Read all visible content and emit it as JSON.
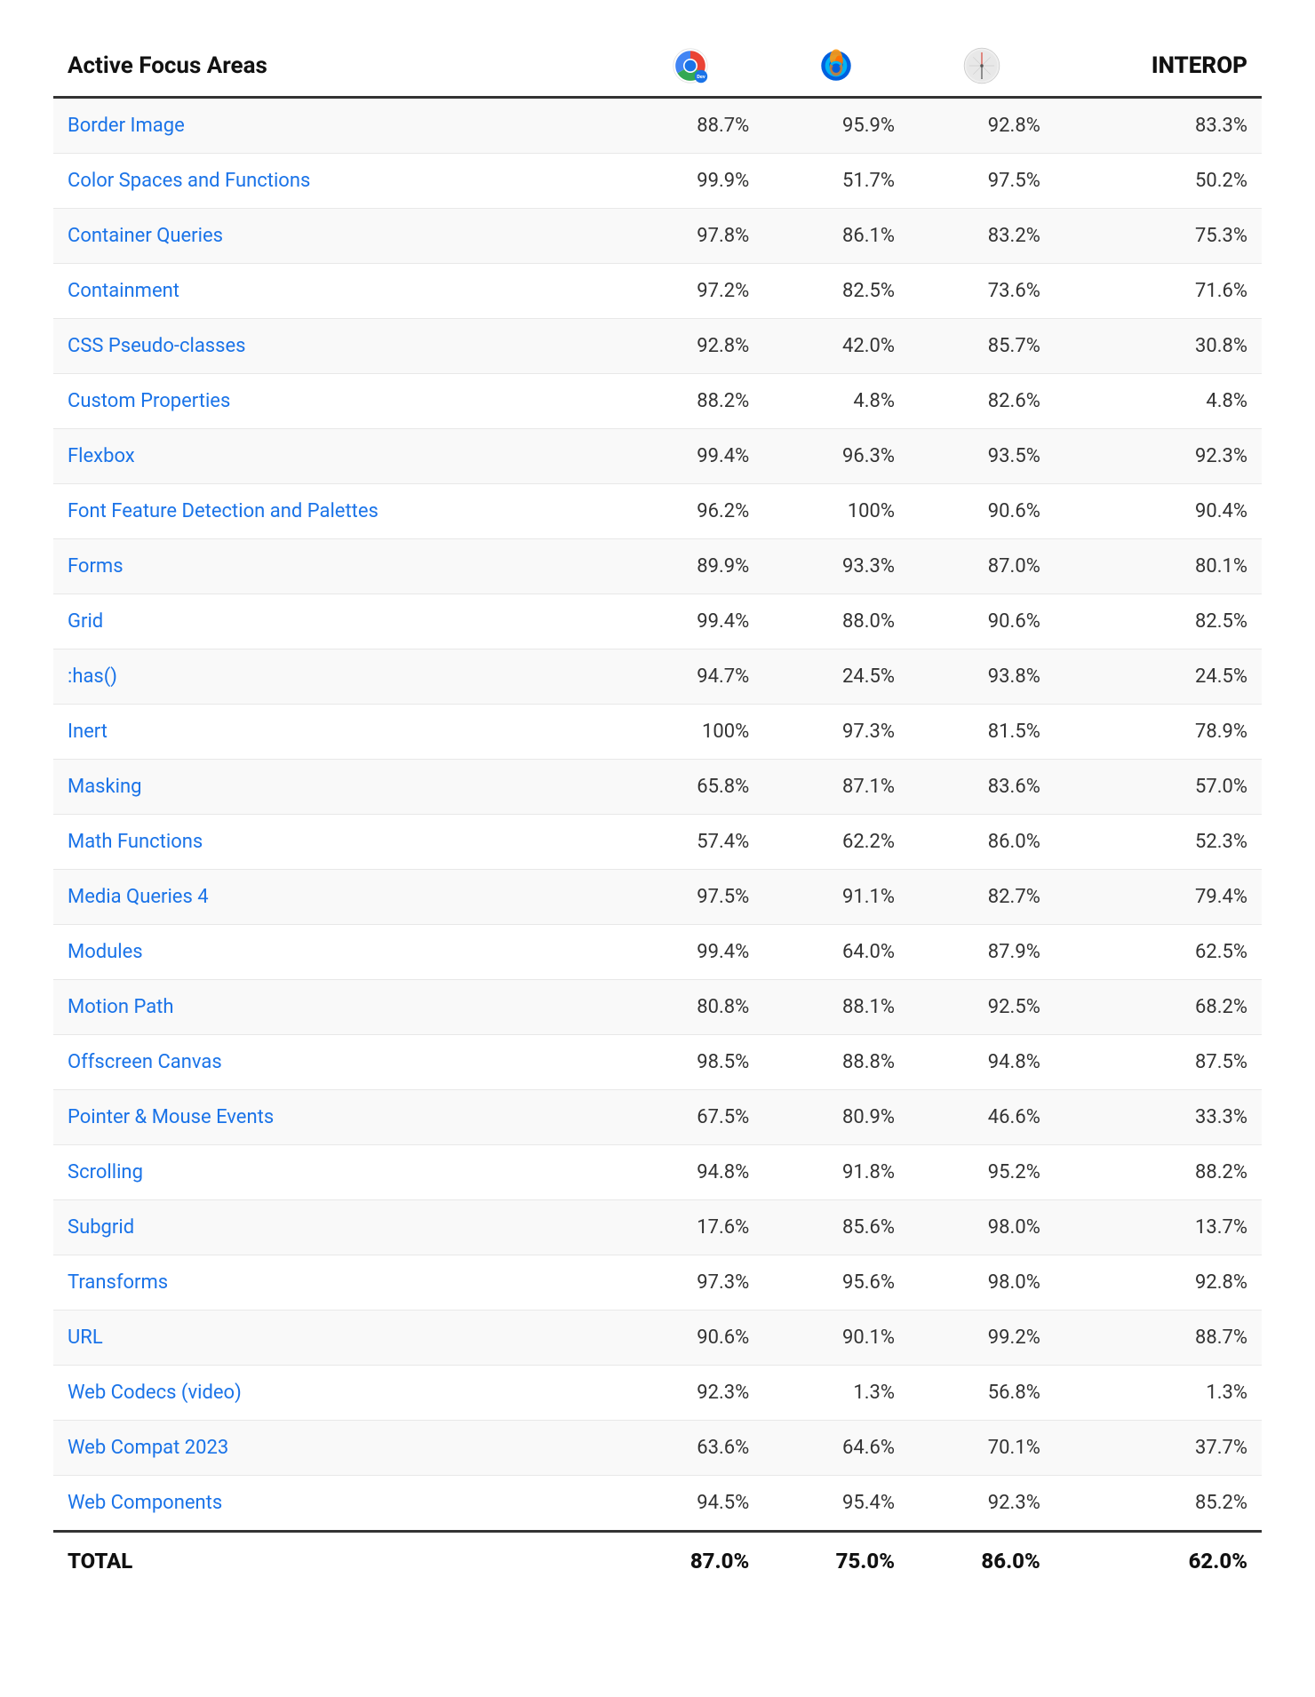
{
  "header": {
    "area_col_label": "Active Focus Areas",
    "interop_label": "INTEROP"
  },
  "rows": [
    {
      "name": "Border Image",
      "chrome": "88.7%",
      "firefox": "95.9%",
      "safari": "92.8%",
      "interop": "83.3%"
    },
    {
      "name": "Color Spaces and Functions",
      "chrome": "99.9%",
      "firefox": "51.7%",
      "safari": "97.5%",
      "interop": "50.2%"
    },
    {
      "name": "Container Queries",
      "chrome": "97.8%",
      "firefox": "86.1%",
      "safari": "83.2%",
      "interop": "75.3%"
    },
    {
      "name": "Containment",
      "chrome": "97.2%",
      "firefox": "82.5%",
      "safari": "73.6%",
      "interop": "71.6%"
    },
    {
      "name": "CSS Pseudo-classes",
      "chrome": "92.8%",
      "firefox": "42.0%",
      "safari": "85.7%",
      "interop": "30.8%"
    },
    {
      "name": "Custom Properties",
      "chrome": "88.2%",
      "firefox": "4.8%",
      "safari": "82.6%",
      "interop": "4.8%"
    },
    {
      "name": "Flexbox",
      "chrome": "99.4%",
      "firefox": "96.3%",
      "safari": "93.5%",
      "interop": "92.3%"
    },
    {
      "name": "Font Feature Detection and Palettes",
      "chrome": "96.2%",
      "firefox": "100%",
      "safari": "90.6%",
      "interop": "90.4%"
    },
    {
      "name": "Forms",
      "chrome": "89.9%",
      "firefox": "93.3%",
      "safari": "87.0%",
      "interop": "80.1%"
    },
    {
      "name": "Grid",
      "chrome": "99.4%",
      "firefox": "88.0%",
      "safari": "90.6%",
      "interop": "82.5%"
    },
    {
      "name": ":has()",
      "chrome": "94.7%",
      "firefox": "24.5%",
      "safari": "93.8%",
      "interop": "24.5%"
    },
    {
      "name": "Inert",
      "chrome": "100%",
      "firefox": "97.3%",
      "safari": "81.5%",
      "interop": "78.9%"
    },
    {
      "name": "Masking",
      "chrome": "65.8%",
      "firefox": "87.1%",
      "safari": "83.6%",
      "interop": "57.0%"
    },
    {
      "name": "Math Functions",
      "chrome": "57.4%",
      "firefox": "62.2%",
      "safari": "86.0%",
      "interop": "52.3%"
    },
    {
      "name": "Media Queries 4",
      "chrome": "97.5%",
      "firefox": "91.1%",
      "safari": "82.7%",
      "interop": "79.4%"
    },
    {
      "name": "Modules",
      "chrome": "99.4%",
      "firefox": "64.0%",
      "safari": "87.9%",
      "interop": "62.5%"
    },
    {
      "name": "Motion Path",
      "chrome": "80.8%",
      "firefox": "88.1%",
      "safari": "92.5%",
      "interop": "68.2%"
    },
    {
      "name": "Offscreen Canvas",
      "chrome": "98.5%",
      "firefox": "88.8%",
      "safari": "94.8%",
      "interop": "87.5%"
    },
    {
      "name": "Pointer & Mouse Events",
      "chrome": "67.5%",
      "firefox": "80.9%",
      "safari": "46.6%",
      "interop": "33.3%"
    },
    {
      "name": "Scrolling",
      "chrome": "94.8%",
      "firefox": "91.8%",
      "safari": "95.2%",
      "interop": "88.2%"
    },
    {
      "name": "Subgrid",
      "chrome": "17.6%",
      "firefox": "85.6%",
      "safari": "98.0%",
      "interop": "13.7%"
    },
    {
      "name": "Transforms",
      "chrome": "97.3%",
      "firefox": "95.6%",
      "safari": "98.0%",
      "interop": "92.8%"
    },
    {
      "name": "URL",
      "chrome": "90.6%",
      "firefox": "90.1%",
      "safari": "99.2%",
      "interop": "88.7%"
    },
    {
      "name": "Web Codecs (video)",
      "chrome": "92.3%",
      "firefox": "1.3%",
      "safari": "56.8%",
      "interop": "1.3%"
    },
    {
      "name": "Web Compat 2023",
      "chrome": "63.6%",
      "firefox": "64.6%",
      "safari": "70.1%",
      "interop": "37.7%"
    },
    {
      "name": "Web Components",
      "chrome": "94.5%",
      "firefox": "95.4%",
      "safari": "92.3%",
      "interop": "85.2%"
    }
  ],
  "total": {
    "label": "TOTAL",
    "chrome": "87.0%",
    "firefox": "75.0%",
    "safari": "86.0%",
    "interop": "62.0%"
  }
}
